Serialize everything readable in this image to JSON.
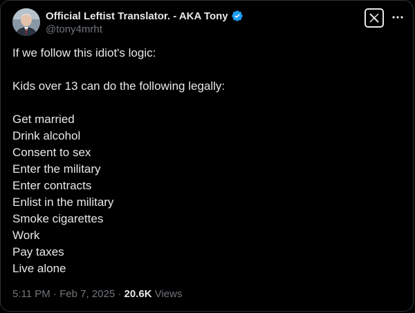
{
  "author": {
    "display_name": "Official Leftist Translator. - AKA Tony",
    "handle": "@tony4mrht",
    "verified": true,
    "verified_color": "#1d9bf0"
  },
  "header": {
    "logo_icon": "x-logo-icon",
    "more_icon": "more-icon"
  },
  "tweet": {
    "intro": "If we follow this idiot's logic:",
    "lead": "Kids over 13 can do the following legally:",
    "items": [
      "Get married",
      "Drink alcohol",
      "Consent to sex",
      "Enter the military",
      "Enter contracts",
      "Enlist in the military",
      "Smoke cigarettes",
      "Work",
      "Pay taxes",
      "Live alone"
    ]
  },
  "meta": {
    "time": "5:11 PM",
    "separator": " · ",
    "date": "Feb 7, 2025",
    "views_count": "20.6K",
    "views_label": " Views"
  },
  "colors": {
    "background": "#000000",
    "text": "#e7e9ea",
    "muted": "#71767b",
    "border": "#2f3336"
  }
}
